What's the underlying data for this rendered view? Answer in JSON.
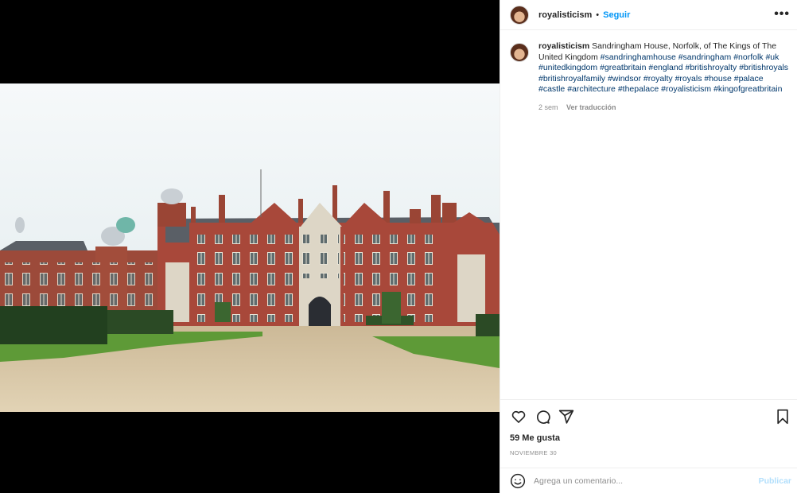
{
  "post": {
    "username": "royalisticism",
    "follow_label": "Seguir",
    "separator": "•",
    "more_label": "•••",
    "caption_text": "Sandringham House, Norfolk, of The Kings of The United Kingdom",
    "hashtags": [
      "#sandringhamhouse",
      "#sandringham",
      "#norfolk",
      "#uk",
      "#unitedkingdom",
      "#greatbritain",
      "#england",
      "#britishroyalty",
      "#britishroyals",
      "#britishroyalfamily",
      "#windsor",
      "#royalty",
      "#royals",
      "#house",
      "#palace",
      "#castle",
      "#architecture",
      "#thepalace",
      "#royalisticism",
      "#kingofgreatbritain"
    ],
    "time_ago": "2 sem",
    "translate_label": "Ver traducción",
    "likes": "59 Me gusta",
    "date": "NOVIEMBRE 30"
  },
  "comment": {
    "placeholder": "Agrega un comentario...",
    "publish_label": "Publicar"
  },
  "icons": {
    "like": "heart-icon",
    "comment": "comment-icon",
    "share": "share-icon",
    "save": "bookmark-icon",
    "emoji": "emoji-icon",
    "more": "more-options-icon"
  },
  "colors": {
    "link_blue": "#0095f6",
    "hashtag": "#00376b",
    "muted": "#8e8e8e",
    "publish_disabled": "#b2dffc"
  }
}
